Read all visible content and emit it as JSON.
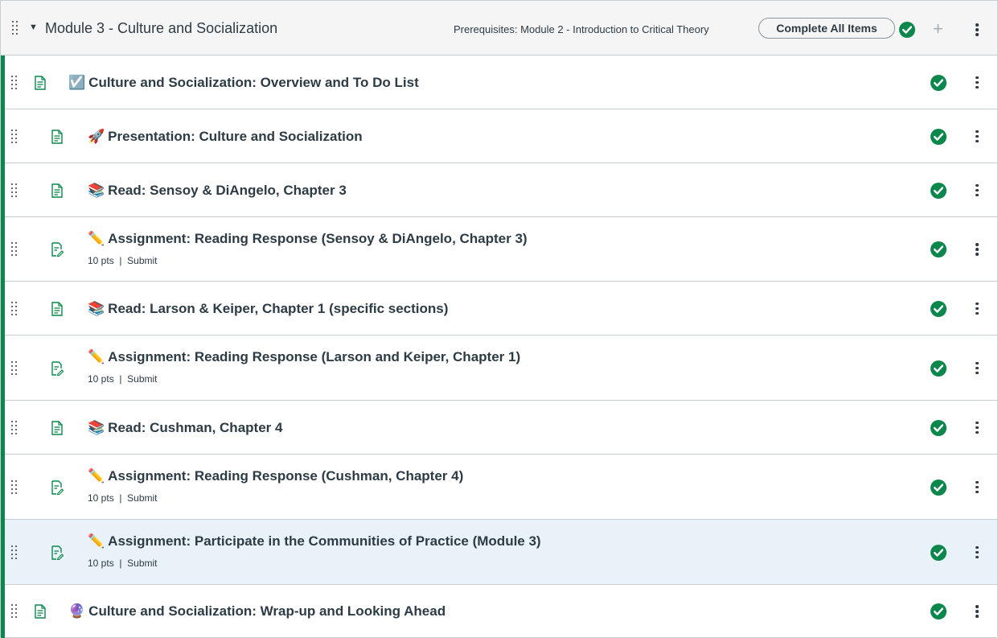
{
  "module": {
    "title": "Module 3 - Culture and Socialization",
    "prerequisites": "Prerequisites: Module 2 - Introduction to Critical Theory",
    "complete_all_label": "Complete All Items",
    "accent_color": "#0b874b"
  },
  "items": [
    {
      "emoji": "☑️",
      "title": "Culture and Socialization: Overview and To Do List",
      "icon": "page-icon"
    },
    {
      "emoji": "🚀",
      "title": "Presentation: Culture and Socialization",
      "icon": "page-icon"
    },
    {
      "emoji": "📚",
      "title": "Read: Sensoy & DiAngelo, Chapter 3",
      "icon": "page-icon"
    },
    {
      "emoji": "✏️",
      "title": "Assignment: Reading Response (Sensoy & DiAngelo, Chapter 3)",
      "icon": "assignment-icon",
      "points": "10 pts",
      "action": "Submit"
    },
    {
      "emoji": "📚",
      "title": "Read: Larson & Keiper, Chapter 1 (specific sections)",
      "icon": "page-icon"
    },
    {
      "emoji": "✏️",
      "title": "Assignment: Reading Response (Larson and Keiper, Chapter 1)",
      "icon": "assignment-icon",
      "points": "10 pts",
      "action": "Submit"
    },
    {
      "emoji": "📚",
      "title": "Read: Cushman, Chapter 4",
      "icon": "page-icon"
    },
    {
      "emoji": "✏️",
      "title": "Assignment: Reading Response (Cushman, Chapter 4)",
      "icon": "assignment-icon",
      "points": "10 pts",
      "action": "Submit"
    },
    {
      "emoji": "✏️",
      "title": "Assignment: Participate in the Communities of Practice (Module 3)",
      "icon": "assignment-icon",
      "points": "10 pts",
      "action": "Submit"
    },
    {
      "emoji": "🔮",
      "title": "Culture and Socialization: Wrap-up and Looking Ahead",
      "icon": "page-icon"
    }
  ]
}
